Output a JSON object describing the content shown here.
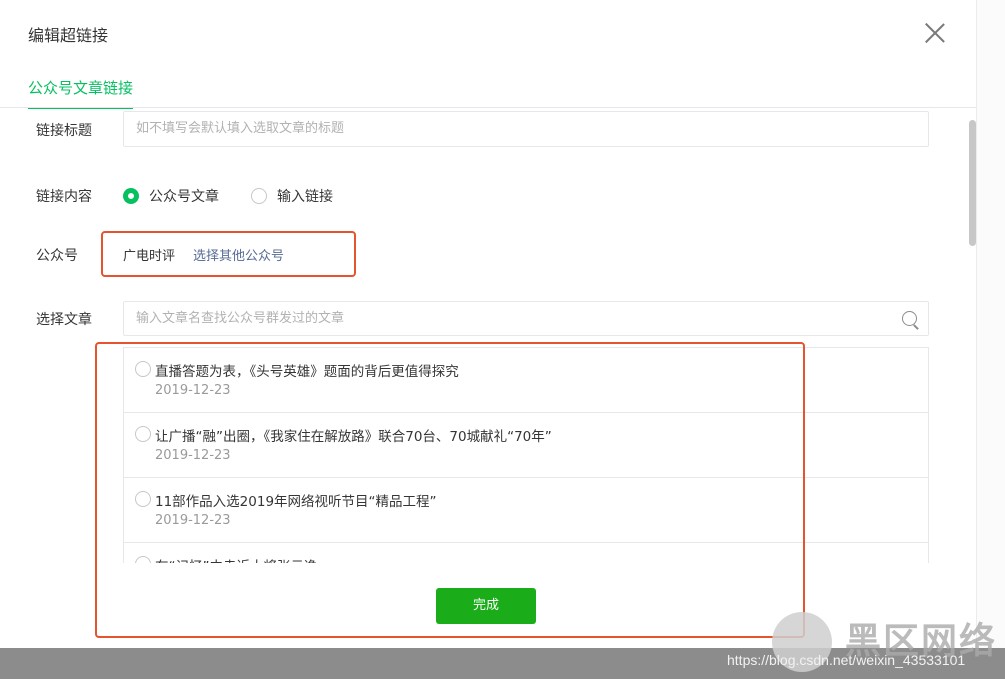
{
  "dialog": {
    "title": "编辑超链接",
    "tab": "公众号文章链接"
  },
  "form": {
    "link_title_label": "链接标题",
    "link_title_placeholder": "如不填写会默认填入选取文章的标题",
    "link_content_label": "链接内容",
    "radio_article": "公众号文章",
    "radio_input_link": "输入链接",
    "account_label": "公众号",
    "account_name": "广电时评",
    "choose_other_account": "选择其他公众号",
    "select_article_label": "选择文章",
    "search_placeholder": "输入文章名查找公众号群发过的文章"
  },
  "articles": [
    {
      "title": "直播答题为表，《头号英雄》题面的背后更值得探究",
      "date": "2019-12-23"
    },
    {
      "title": "让广播“融”出圈，《我家住在解放路》联合70台、70城献礼“70年”",
      "date": "2019-12-23"
    },
    {
      "title": "11部作品入选2019年网络视听节目“精品工程”",
      "date": "2019-12-23"
    },
    {
      "title": "在“记忆”中走近大将张云逸",
      "date": ""
    }
  ],
  "done_button": "完成",
  "watermark": {
    "url": "https://blog.csdn.net/weixin_43533101",
    "logo_text": "黑区网络"
  },
  "colors": {
    "accent_green": "#07c160",
    "button_green": "#1aad19",
    "link_blue": "#576b95",
    "highlight_red": "#e5542e"
  }
}
